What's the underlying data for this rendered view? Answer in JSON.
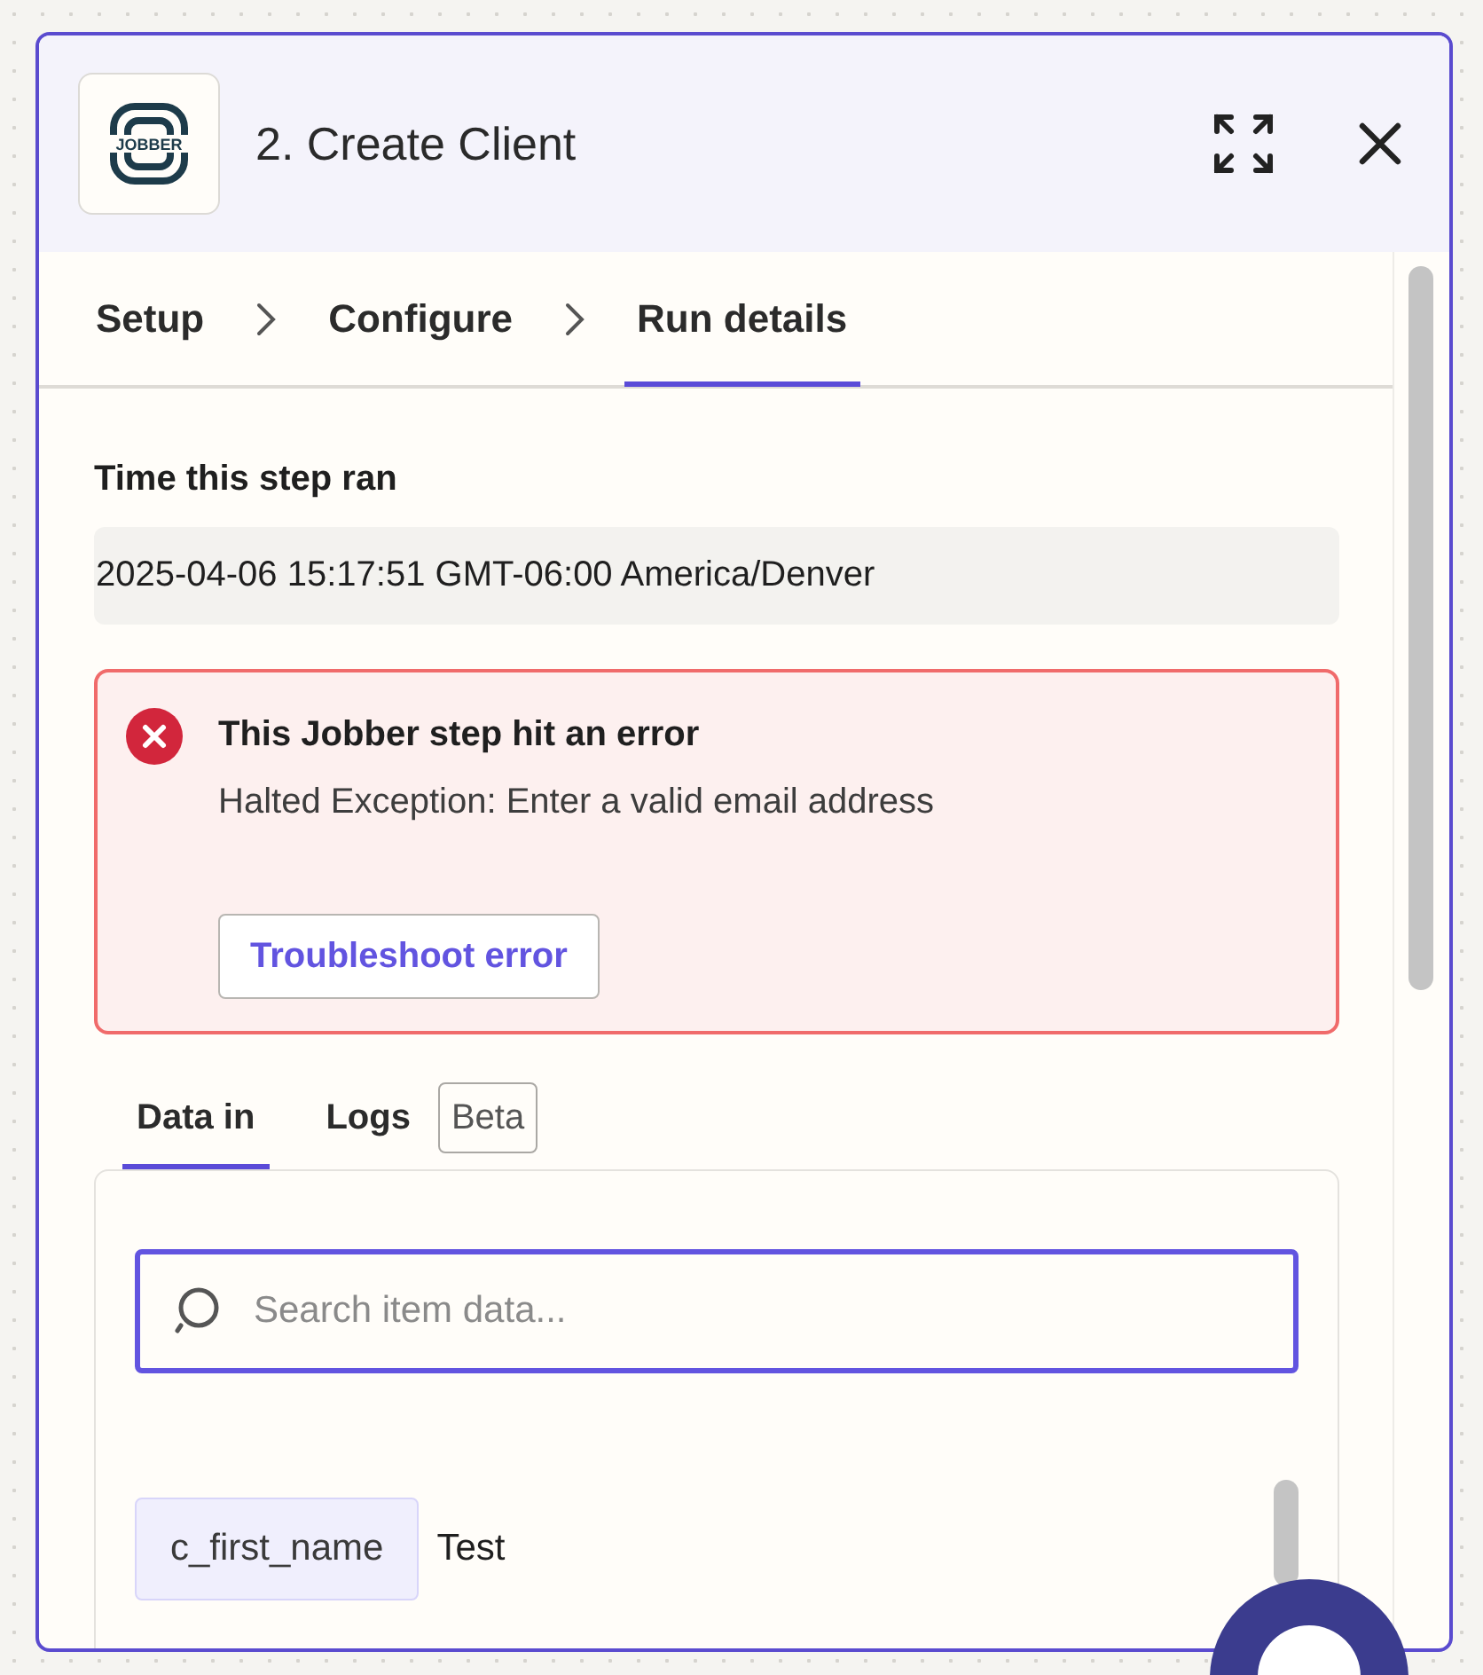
{
  "panel": {
    "title": "2. Create Client",
    "logo_text": "JOBBER"
  },
  "steps": [
    {
      "label": "Setup",
      "selected": false
    },
    {
      "label": "Configure",
      "selected": false
    },
    {
      "label": "Run details",
      "selected": true
    }
  ],
  "time_section": {
    "label": "Time this step ran",
    "value": "2025-04-06 15:17:51 GMT-06:00 America/Denver"
  },
  "error": {
    "title": "This Jobber step hit an error",
    "message": "Halted Exception: Enter a valid email address",
    "button": "Troubleshoot error"
  },
  "data_tabs": [
    {
      "label": "Data in",
      "selected": true
    },
    {
      "label": "Logs",
      "selected": false,
      "badge": "Beta"
    }
  ],
  "search": {
    "placeholder": "Search item data..."
  },
  "rows": [
    {
      "key": "c_first_name",
      "value": "Test"
    }
  ]
}
